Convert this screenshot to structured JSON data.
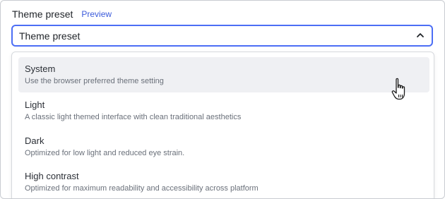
{
  "field": {
    "label": "Theme preset",
    "badge": "Preview",
    "selected_value": "Theme preset"
  },
  "dropdown": {
    "options": [
      {
        "title": "System",
        "description": "Use the browser preferred theme setting",
        "highlighted": true
      },
      {
        "title": "Light",
        "description": "A classic light themed interface with clean traditional aesthetics",
        "highlighted": false
      },
      {
        "title": "Dark",
        "description": "Optimized for low light and reduced eye strain.",
        "highlighted": false
      },
      {
        "title": "High contrast",
        "description": "Optimized for maximum readability and accessibility across platform",
        "highlighted": false
      }
    ]
  },
  "icons": {
    "select_toggle": "chevron-up-icon",
    "pointer": "hand-pointer-cursor-icon"
  },
  "colors": {
    "accent": "#4c6ef5",
    "badge": "#3b5bdb",
    "highlight": "#eff0f3"
  }
}
